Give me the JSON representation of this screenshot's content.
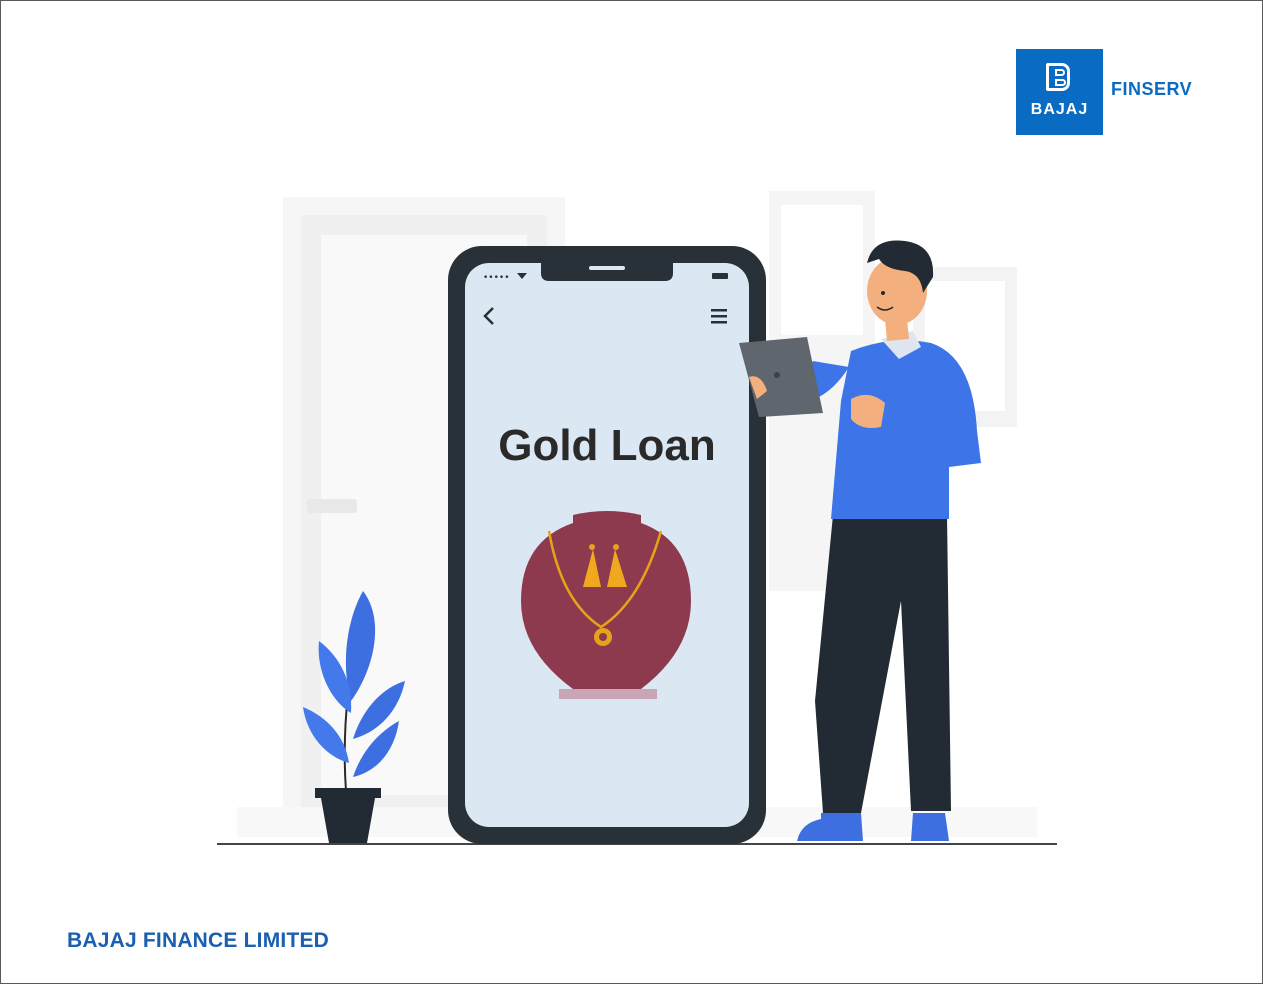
{
  "brand": {
    "logo_word": "BAJAJ",
    "logo_text": "FINSERV",
    "footer": "BAJAJ FINANCE LIMITED",
    "primary_color": "#0a6bc2"
  },
  "phone": {
    "title": "Gold Loan",
    "back_icon": "chevron-left-icon",
    "menu_icon": "hamburger-icon"
  }
}
